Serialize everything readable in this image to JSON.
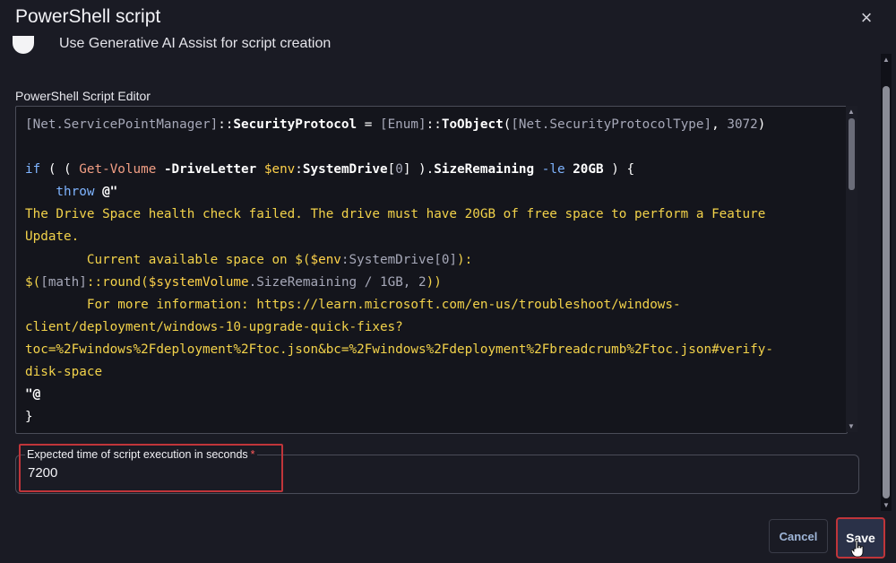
{
  "dialog": {
    "title": "PowerShell script",
    "close_icon": "×"
  },
  "ai_assist": {
    "label": "Use Generative AI Assist for script creation"
  },
  "editor": {
    "label": "PowerShell Script Editor",
    "lines": [
      [
        {
          "t": "[Net.ServicePointManager]",
          "c": "type"
        },
        {
          "t": "::",
          "c": "op"
        },
        {
          "t": "SecurityProtocol",
          "c": "bold"
        },
        {
          "t": " = ",
          "c": "op"
        },
        {
          "t": "[Enum]",
          "c": "type"
        },
        {
          "t": "::",
          "c": "op"
        },
        {
          "t": "ToObject",
          "c": "bold"
        },
        {
          "t": "(",
          "c": "op"
        },
        {
          "t": "[Net.SecurityProtocolType]",
          "c": "type"
        },
        {
          "t": ", ",
          "c": "op"
        },
        {
          "t": "3072",
          "c": "num"
        },
        {
          "t": ")",
          "c": "op"
        }
      ],
      [],
      [
        {
          "t": "if",
          "c": "kw"
        },
        {
          "t": " ( ( ",
          "c": "op"
        },
        {
          "t": "Get-Volume",
          "c": "cmd"
        },
        {
          "t": " ",
          "c": "op"
        },
        {
          "t": "-DriveLetter",
          "c": "bold"
        },
        {
          "t": " ",
          "c": "op"
        },
        {
          "t": "$env",
          "c": "var"
        },
        {
          "t": ":",
          "c": "op"
        },
        {
          "t": "SystemDrive",
          "c": "bold"
        },
        {
          "t": "[",
          "c": "op"
        },
        {
          "t": "0",
          "c": "num"
        },
        {
          "t": "] ).",
          "c": "op"
        },
        {
          "t": "SizeRemaining",
          "c": "bold"
        },
        {
          "t": " -le ",
          "c": "kw"
        },
        {
          "t": "20GB",
          "c": "bold"
        },
        {
          "t": " ) {",
          "c": "op"
        }
      ],
      [
        {
          "t": "    throw",
          "c": "kw"
        },
        {
          "t": " @\"",
          "c": "bold"
        }
      ],
      [
        {
          "t": "The Drive Space health check failed. The drive must have 20GB of free space to perform a Feature",
          "c": "str"
        }
      ],
      [
        {
          "t": "Update.",
          "c": "str"
        }
      ],
      [
        {
          "t": "        Current available space on ",
          "c": "str"
        },
        {
          "t": "$(",
          "c": "str"
        },
        {
          "t": "$env",
          "c": "var"
        },
        {
          "t": ":SystemDrive",
          "c": "type"
        },
        {
          "t": "[0]",
          "c": "type"
        },
        {
          "t": "):",
          "c": "str"
        }
      ],
      [
        {
          "t": "$(",
          "c": "str"
        },
        {
          "t": "[math]",
          "c": "type"
        },
        {
          "t": "::",
          "c": "str"
        },
        {
          "t": "round",
          "c": "str"
        },
        {
          "t": "(",
          "c": "str"
        },
        {
          "t": "$systemVolume",
          "c": "var"
        },
        {
          "t": ".SizeRemaining / 1GB, 2",
          "c": "type"
        },
        {
          "t": "))",
          "c": "str"
        }
      ],
      [
        {
          "t": "        For more information: https://learn.microsoft.com/en-us/troubleshoot/windows-",
          "c": "str"
        }
      ],
      [
        {
          "t": "client/deployment/windows-10-upgrade-quick-fixes?",
          "c": "str"
        }
      ],
      [
        {
          "t": "toc=%2Fwindows%2Fdeployment%2Ftoc.json&bc=%2Fwindows%2Fdeployment%2Fbreadcrumb%2Ftoc.json#verify-",
          "c": "str"
        }
      ],
      [
        {
          "t": "disk-space",
          "c": "str"
        }
      ],
      [
        {
          "t": "\"@",
          "c": "bold"
        }
      ],
      [
        {
          "t": "}",
          "c": "op"
        }
      ]
    ]
  },
  "execution_time": {
    "label": "Expected time of script execution in seconds",
    "required_mark": "*",
    "value": "7200"
  },
  "actions": {
    "cancel_label": "Cancel",
    "save_label": "Save"
  },
  "colors": {
    "background": "#1a1b24",
    "highlight_box": "#c0353a",
    "string": "#f2d24a",
    "variable": "#ffd24a",
    "keyword": "#7fb4ff",
    "cmdlet": "#f29e84"
  }
}
